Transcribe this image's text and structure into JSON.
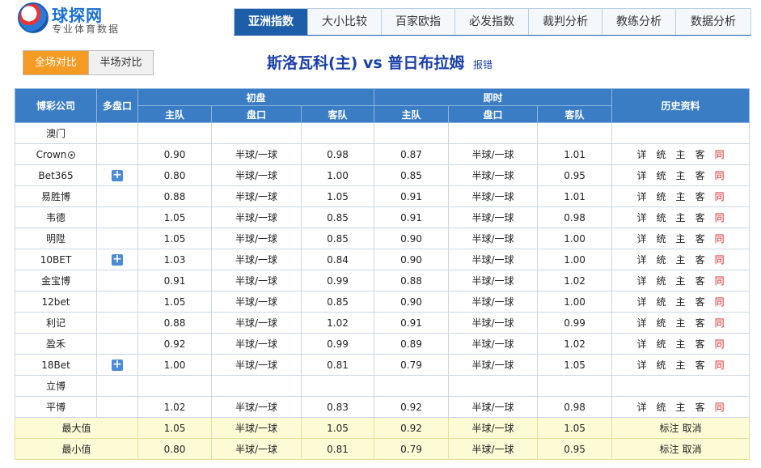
{
  "logo": {
    "name": "球探网",
    "subtitle": "专业体育数据"
  },
  "nav": {
    "tabs": [
      "亚洲指数",
      "大小比较",
      "百家欧指",
      "必发指数",
      "裁判分析",
      "教练分析",
      "数据分析"
    ]
  },
  "switch": {
    "full": "全场对比",
    "half": "半场对比"
  },
  "match": {
    "home": "斯洛瓦科(主)",
    "vs": "vs",
    "away": "普日布拉姆",
    "report": "报错"
  },
  "table": {
    "headers": {
      "company": "博彩公司",
      "multi": "多盘口",
      "initial": "初盘",
      "live": "即时",
      "history": "历史资料",
      "home": "主队",
      "line": "盘口",
      "away": "客队"
    },
    "rows": [
      {
        "company": "澳门",
        "multi": false,
        "i_home": "",
        "i_line": "",
        "i_away": "",
        "l_home": "",
        "l_line": "",
        "l_away": "",
        "links": false
      },
      {
        "company": "Crown",
        "ball": true,
        "multi": false,
        "i_home": "0.90",
        "i_line": "半球/一球",
        "i_away": "0.98",
        "l_home": "0.87",
        "l_line": "半球/一球",
        "l_away": "1.01",
        "links": true
      },
      {
        "company": "Bet365",
        "multi": true,
        "i_home": "0.80",
        "i_line": "半球/一球",
        "i_away": "1.00",
        "l_home": "0.85",
        "l_line": "半球/一球",
        "l_away": "0.95",
        "links": true
      },
      {
        "company": "易胜博",
        "multi": false,
        "i_home": "0.88",
        "i_line": "半球/一球",
        "i_away": "1.05",
        "l_home": "0.91",
        "l_line": "半球/一球",
        "l_away": "1.01",
        "links": true
      },
      {
        "company": "韦德",
        "multi": false,
        "i_home": "1.05",
        "i_line": "半球/一球",
        "i_away": "0.85",
        "l_home": "0.91",
        "l_line": "半球/一球",
        "l_away": "0.98",
        "links": true
      },
      {
        "company": "明陞",
        "multi": false,
        "i_home": "1.05",
        "i_line": "半球/一球",
        "i_away": "0.85",
        "l_home": "0.90",
        "l_line": "半球/一球",
        "l_away": "1.00",
        "links": true
      },
      {
        "company": "10BET",
        "multi": true,
        "i_home": "1.03",
        "i_line": "半球/一球",
        "i_away": "0.84",
        "l_home": "0.90",
        "l_line": "半球/一球",
        "l_away": "1.00",
        "links": true
      },
      {
        "company": "金宝博",
        "multi": false,
        "i_home": "0.91",
        "i_line": "半球/一球",
        "i_away": "0.99",
        "l_home": "0.88",
        "l_line": "半球/一球",
        "l_away": "1.02",
        "links": true
      },
      {
        "company": "12bet",
        "multi": false,
        "i_home": "1.05",
        "i_line": "半球/一球",
        "i_away": "0.85",
        "l_home": "0.90",
        "l_line": "半球/一球",
        "l_away": "1.00",
        "links": true
      },
      {
        "company": "利记",
        "multi": false,
        "i_home": "0.88",
        "i_line": "半球/一球",
        "i_away": "1.02",
        "l_home": "0.91",
        "l_line": "半球/一球",
        "l_away": "0.99",
        "links": true
      },
      {
        "company": "盈禾",
        "multi": false,
        "i_home": "0.92",
        "i_line": "半球/一球",
        "i_away": "0.99",
        "l_home": "0.89",
        "l_line": "半球/一球",
        "l_away": "1.02",
        "links": true
      },
      {
        "company": "18Bet",
        "multi": true,
        "i_home": "1.00",
        "i_line": "半球/一球",
        "i_away": "0.81",
        "l_home": "0.79",
        "l_line": "半球/一球",
        "l_away": "1.05",
        "links": true
      },
      {
        "company": "立博",
        "multi": false,
        "i_home": "",
        "i_line": "",
        "i_away": "",
        "l_home": "",
        "l_line": "",
        "l_away": "",
        "links": false
      },
      {
        "company": "平博",
        "multi": false,
        "i_home": "1.02",
        "i_line": "半球/一球",
        "i_away": "0.83",
        "l_home": "0.92",
        "l_line": "半球/一球",
        "l_away": "0.98",
        "links": true
      }
    ],
    "links": [
      "详",
      "统",
      "主",
      "客",
      "同"
    ],
    "summary": [
      {
        "label": "最大值",
        "i_home": "1.05",
        "i_line": "半球/一球",
        "i_away": "1.05",
        "l_home": "0.92",
        "l_line": "半球/一球",
        "l_away": "1.05",
        "mark": "标注",
        "cancel": "取消"
      },
      {
        "label": "最小值",
        "i_home": "0.80",
        "i_line": "半球/一球",
        "i_away": "0.81",
        "l_home": "0.79",
        "l_line": "半球/一球",
        "l_away": "0.95",
        "mark": "标注",
        "cancel": "取消"
      }
    ]
  }
}
